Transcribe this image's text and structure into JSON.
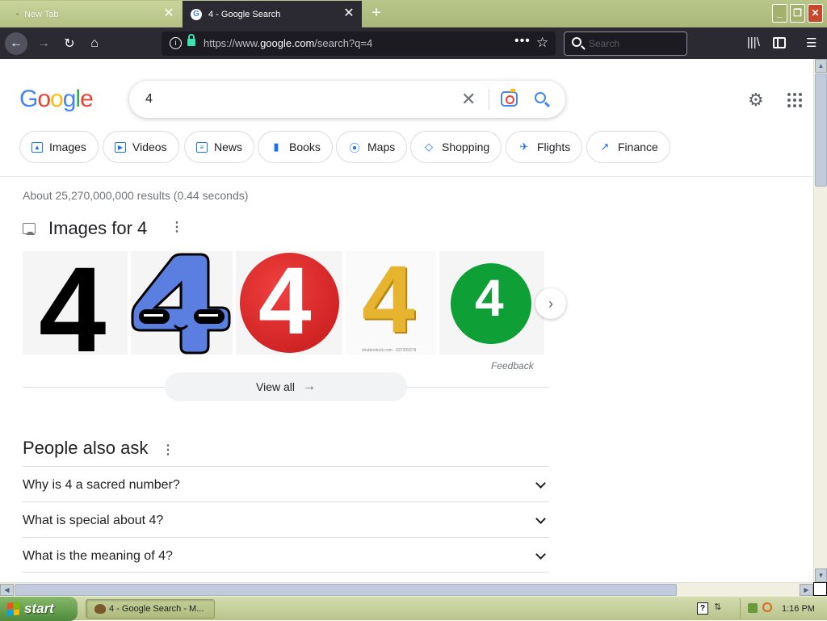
{
  "browser": {
    "tabs": [
      {
        "label": "New Tab",
        "active": false
      },
      {
        "label": "4 - Google Search",
        "active": true
      }
    ],
    "url_prefix": "https://www.",
    "url_domain": "google.com",
    "url_path": "/search?q=4",
    "search_placeholder": "Search",
    "window_buttons": {
      "minimize": "_",
      "maximize": "❐",
      "close": "✕"
    }
  },
  "google": {
    "logo": {
      "g1": "G",
      "o1": "o",
      "o2": "o",
      "g2": "g",
      "l": "l",
      "e": "e"
    },
    "query": "4",
    "chips": [
      {
        "label": "Images"
      },
      {
        "label": "Videos"
      },
      {
        "label": "News"
      },
      {
        "label": "Books"
      },
      {
        "label": "Maps"
      },
      {
        "label": "Shopping"
      },
      {
        "label": "Flights"
      },
      {
        "label": "Finance"
      }
    ],
    "result_stats": "About 25,270,000,000 results (0.44 seconds)",
    "images_section": {
      "title": "Images for 4",
      "thumbs": [
        {
          "glyph": "4"
        },
        {
          "glyph": "4"
        },
        {
          "glyph": "4"
        },
        {
          "glyph": "4",
          "watermark": "shutterstock.com · 637209379"
        },
        {
          "glyph": "4"
        }
      ],
      "feedback": "Feedback",
      "view_all": "View all"
    },
    "people_also_ask": {
      "title": "People also ask",
      "questions": [
        "Why is 4 a sacred number?",
        "What is special about 4?",
        "What is the meaning of 4?"
      ]
    }
  },
  "taskbar": {
    "start_label": "start",
    "task_item": "4 - Google Search - M...",
    "clock": "1:16 PM"
  },
  "colors": {
    "google_blue": "#4285f4",
    "google_red": "#ea4335",
    "google_yellow": "#fbbc05",
    "google_green": "#34a853",
    "browser_dark": "#2b2a33"
  }
}
